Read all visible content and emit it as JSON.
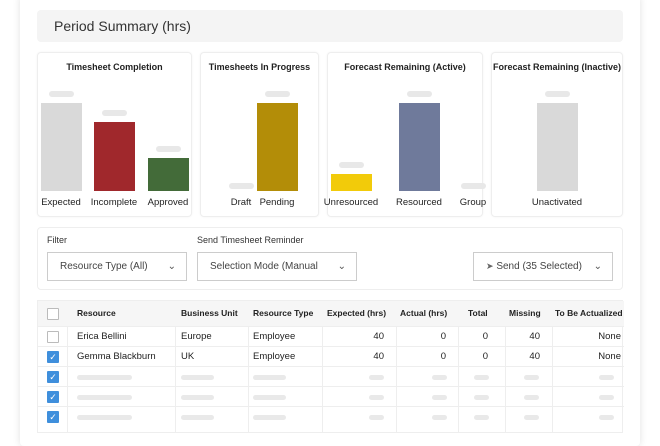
{
  "header": {
    "title": "Period Summary (hrs)"
  },
  "chart_data": [
    {
      "type": "bar",
      "title": "Timesheet Completion",
      "categories": [
        "Expected",
        "Incomplete",
        "Approved"
      ],
      "values": [
        100,
        78,
        38
      ],
      "colors": [
        "#d9d9d9",
        "#a0282c",
        "#436b39"
      ],
      "note_values": "relative bar heights, percent of tallest"
    },
    {
      "type": "bar",
      "title": "Timesheets In Progress",
      "categories": [
        "Draft",
        "Pending"
      ],
      "values": [
        0,
        100
      ],
      "colors": [
        "#d9d9d9",
        "#b38d08"
      ]
    },
    {
      "type": "bar",
      "title": "Forecast Remaining (Active)",
      "categories": [
        "Unresourced",
        "Resourced",
        "Group"
      ],
      "values": [
        19,
        100,
        0
      ],
      "colors": [
        "#f2cb0a",
        "#6f7a9b",
        "#d9d9d9"
      ]
    },
    {
      "type": "bar",
      "title": "Forecast Remaining (Inactive)",
      "categories": [
        "Unactivated"
      ],
      "values": [
        100
      ],
      "colors": [
        "#d9d9d9"
      ]
    }
  ],
  "filter": {
    "label": "Filter",
    "value": "Resource Type (All)"
  },
  "reminder": {
    "label": "Send Timesheet Reminder",
    "value": "Selection Mode (Manual",
    "send_label": "Send (35 Selected)"
  },
  "table": {
    "columns": [
      "Resource",
      "Business Unit",
      "Resource Type",
      "Expected (hrs)",
      "Actual (hrs)",
      "Total",
      "Missing",
      "To Be Actualized"
    ],
    "rows": [
      {
        "checked": false,
        "cells": [
          "Erica Bellini",
          "Europe",
          "Employee",
          "40",
          "0",
          "0",
          "40",
          "None"
        ]
      },
      {
        "checked": true,
        "cells": [
          "Gemma Blackburn",
          "UK",
          "Employee",
          "40",
          "0",
          "0",
          "40",
          "None"
        ]
      },
      {
        "checked": true,
        "placeholder": true
      },
      {
        "checked": true,
        "placeholder": true
      },
      {
        "checked": true,
        "placeholder": true
      }
    ]
  }
}
